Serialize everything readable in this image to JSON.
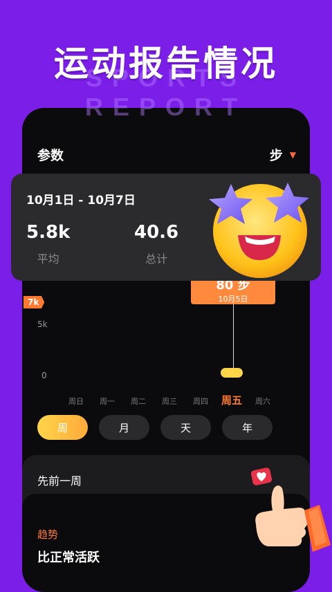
{
  "hero": {
    "title": "运动报告情况",
    "subtitle": "SPORTS REPORT"
  },
  "header": {
    "param_label": "参数",
    "unit": "步"
  },
  "summary": {
    "range": "10月1日 - 10月7日",
    "avg_value": "5.8k",
    "avg_label": "平均",
    "total_value": "40.6",
    "total_label": "总计"
  },
  "chart": {
    "flag": "7k",
    "y5": "5k",
    "y0": "0",
    "tooltip_value": "80 步",
    "tooltip_date": "10月5日"
  },
  "chart_data": {
    "type": "bar",
    "categories": [
      "周日",
      "周一",
      "周二",
      "周三",
      "周四",
      "周五",
      "周六"
    ],
    "values": [
      0,
      0,
      0,
      0,
      0,
      80,
      0
    ],
    "ylim": [
      0,
      7000
    ],
    "ylabel": "",
    "xlabel": "",
    "selected": "周五"
  },
  "periods": [
    "周",
    "月",
    "天",
    "年"
  ],
  "previous": {
    "label": "先前一周"
  },
  "trend": {
    "label": "趋势",
    "text": "比正常活跃"
  }
}
